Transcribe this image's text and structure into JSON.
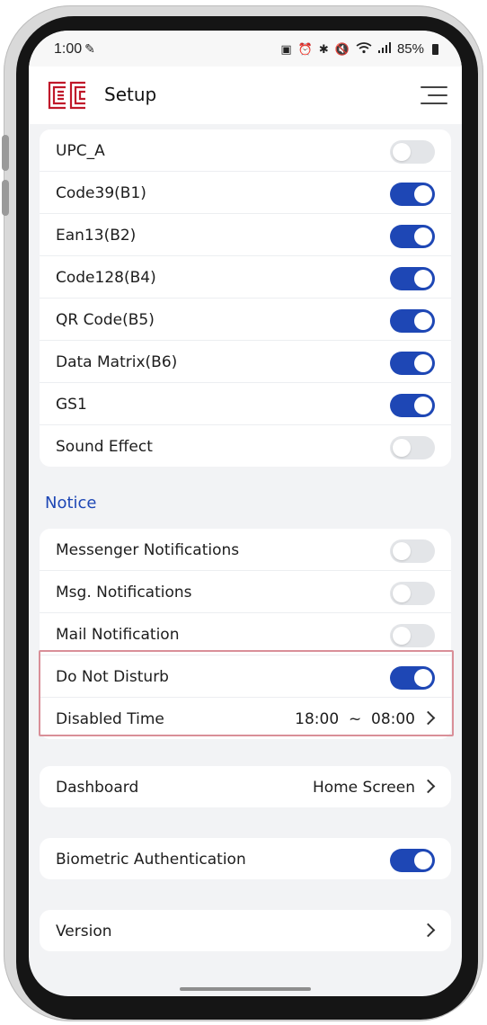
{
  "status_bar": {
    "time": "1:00",
    "battery": "85%"
  },
  "header": {
    "title": "Setup",
    "logo_text": "EC"
  },
  "barcodes": [
    {
      "label": "UPC_A",
      "on": false
    },
    {
      "label": "Code39(B1)",
      "on": true
    },
    {
      "label": "Ean13(B2)",
      "on": true
    },
    {
      "label": "Code128(B4)",
      "on": true
    },
    {
      "label": "QR Code(B5)",
      "on": true
    },
    {
      "label": "Data Matrix(B6)",
      "on": true
    },
    {
      "label": "GS1",
      "on": true
    },
    {
      "label": "Sound Effect",
      "on": false
    }
  ],
  "notice": {
    "title": "Notice",
    "items": [
      {
        "label": "Messenger Notifications",
        "on": false
      },
      {
        "label": "Msg. Notifications",
        "on": false
      },
      {
        "label": "Mail Notification",
        "on": false
      },
      {
        "label": "Do Not Disturb",
        "on": true
      }
    ],
    "disabled_time": {
      "label": "Disabled Time",
      "value": "18:00  ~  08:00"
    }
  },
  "dashboard": {
    "label": "Dashboard",
    "value": "Home Screen"
  },
  "biometric": {
    "label": "Biometric Authentication",
    "on": true
  },
  "version": {
    "label": "Version"
  },
  "colors": {
    "accent": "#1e47b5",
    "logo": "#c0182a",
    "highlight": "#d98f98",
    "background": "#f2f3f5"
  }
}
